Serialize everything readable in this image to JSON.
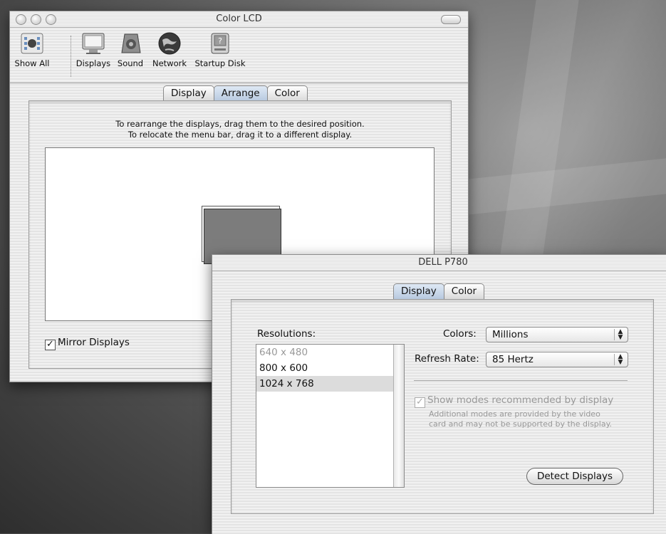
{
  "window1": {
    "title": "Color LCD",
    "toolbar": [
      {
        "label": "Show All",
        "icon": "show-all-icon"
      },
      {
        "label": "Displays",
        "icon": "display-icon"
      },
      {
        "label": "Sound",
        "icon": "speaker-icon"
      },
      {
        "label": "Network",
        "icon": "globe-icon"
      },
      {
        "label": "Startup Disk",
        "icon": "disk-icon"
      }
    ],
    "tabs": [
      "Display",
      "Arrange",
      "Color"
    ],
    "selected_tab": "Arrange",
    "instructions": [
      "To rearrange the displays, drag them to the desired position.",
      "To relocate the menu bar, drag it to a different display."
    ],
    "mirror_displays": {
      "label": "Mirror Displays",
      "checked": true
    }
  },
  "window2": {
    "title": "DELL P780",
    "tabs": [
      "Display",
      "Color"
    ],
    "selected_tab": "Display",
    "resolutions_label": "Resolutions:",
    "resolutions": [
      "640 x 480",
      "800 x 600",
      "1024 x 768"
    ],
    "selected_resolution": "1024 x 768",
    "colors_label": "Colors:",
    "colors_value": "Millions",
    "refresh_label": "Refresh Rate:",
    "refresh_value": "85 Hertz",
    "show_modes": {
      "label": "Show modes recommended by display",
      "checked": true,
      "note_line1": "Additional modes are provided by the video",
      "note_line2": "card and may not be supported by the display."
    },
    "detect_button": "Detect Displays"
  }
}
